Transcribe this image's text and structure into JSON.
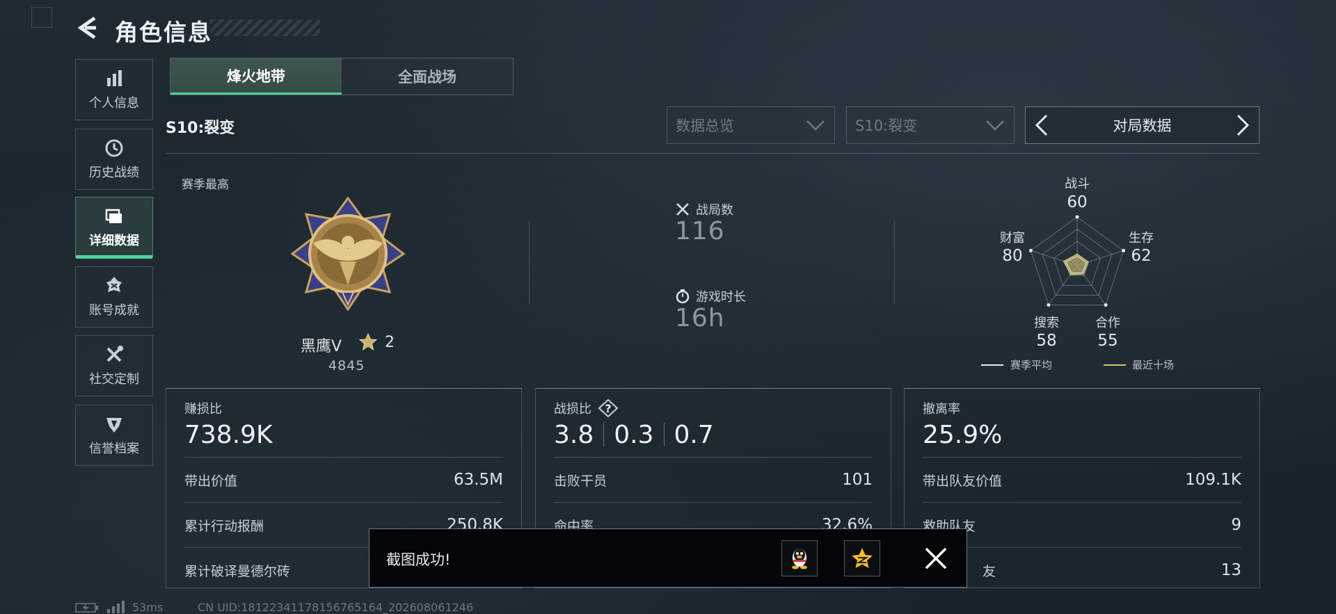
{
  "header": {
    "title": "角色信息"
  },
  "sidebar": {
    "items": [
      {
        "label": "个人信息",
        "icon": "bar-chart-icon"
      },
      {
        "label": "历史战绩",
        "icon": "clock-icon"
      },
      {
        "label": "详细数据",
        "icon": "folder-icon",
        "active": true
      },
      {
        "label": "账号成就",
        "icon": "medal-icon"
      },
      {
        "label": "社交定制",
        "icon": "tools-icon"
      },
      {
        "label": "信誉档案",
        "icon": "shield-icon"
      }
    ]
  },
  "mode_tabs": [
    {
      "label": "烽火地带",
      "active": true
    },
    {
      "label": "全面战场",
      "active": false
    }
  ],
  "season_label": "S10:裂变",
  "filters": {
    "dropdown1": "数据总览",
    "dropdown2": "S10:裂变",
    "pager_label": "对局数据"
  },
  "season_best": {
    "label": "赛季最高",
    "rank_name": "黑鹰V",
    "rank_stars": "2",
    "score": "4845"
  },
  "summary": {
    "matches_label": "战局数",
    "matches_value": "116",
    "playtime_label": "游戏时长",
    "playtime_value": "16h"
  },
  "radar": {
    "axes": [
      {
        "label": "战斗",
        "value": "60",
        "score": 60
      },
      {
        "label": "生存",
        "value": "62",
        "score": 62
      },
      {
        "label": "合作",
        "value": "55",
        "score": 55
      },
      {
        "label": "搜索",
        "value": "58",
        "score": 58
      },
      {
        "label": "财富",
        "value": "80",
        "score": 80
      }
    ],
    "legend_season": "赛季平均",
    "legend_recent": "最近十场",
    "colors": {
      "season": "#e6e9ec",
      "recent": "#d8c26a"
    }
  },
  "panels": {
    "profit": {
      "label": "赚损比",
      "value": "738.9K",
      "rows": [
        {
          "label": "带出价值",
          "value": "63.5M"
        },
        {
          "label": "累计行动报酬",
          "value": "250.8K"
        },
        {
          "label": "累计破译曼德尔砖",
          "value": ""
        }
      ]
    },
    "combat": {
      "label": "战损比",
      "values": [
        "3.8",
        "0.3",
        "0.7"
      ],
      "rows": [
        {
          "label": "击败干员",
          "value": "101"
        },
        {
          "label": "命中率",
          "value": "32.6%"
        }
      ]
    },
    "extract": {
      "label": "撤离率",
      "value": "25.9%",
      "rows": [
        {
          "label": "带出队友价值",
          "value": "109.1K"
        },
        {
          "label": "救助队友",
          "value": "9"
        },
        {
          "label": "友",
          "value": "13"
        }
      ]
    }
  },
  "toast": {
    "message": "截图成功!"
  },
  "footer": {
    "ping": "53ms",
    "uid": "CN UID:18122341178156765164_202608061246"
  }
}
